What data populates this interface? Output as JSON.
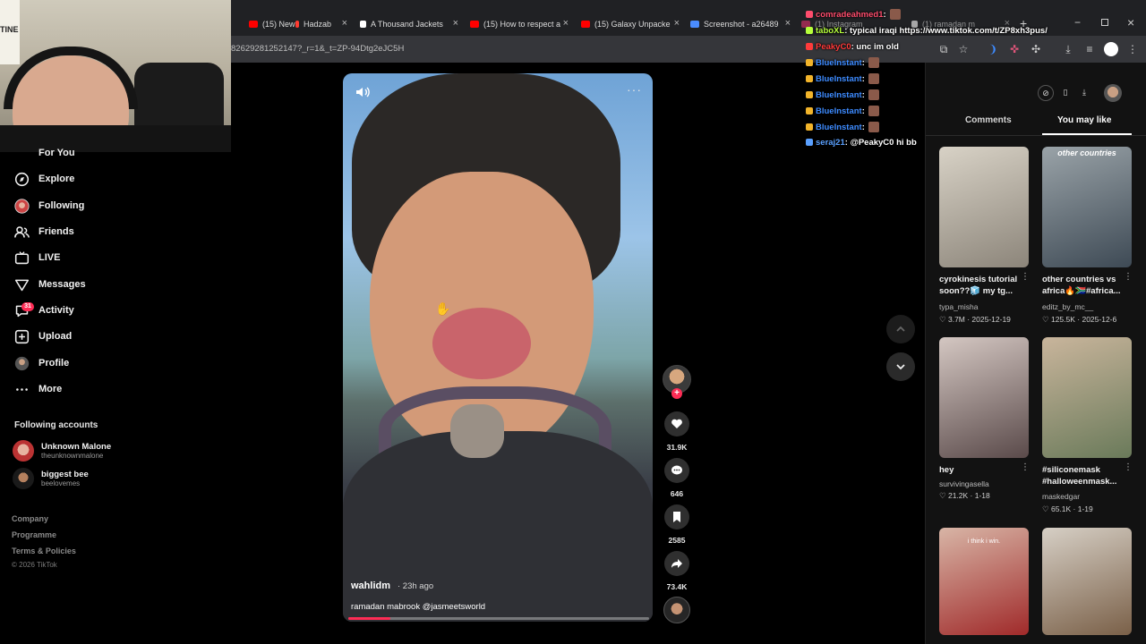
{
  "tabs": [
    {
      "label": "(15) New",
      "color": "#ff0000"
    },
    {
      "label": "Hadzab",
      "color": "#ff3b30"
    },
    {
      "label": "A Thousand Jackets",
      "color": "#ffffff"
    },
    {
      "label": "(15) How to respect a",
      "color": "#ff0000"
    },
    {
      "label": "(15) Galaxy Unpacke",
      "color": "#ff0000"
    },
    {
      "label": "Screenshot - a26489",
      "color": "#4a8cff"
    },
    {
      "label": "(1) Instagram",
      "color": "#e1306c"
    },
    {
      "label": "(1) ramadan m",
      "color": "#ffffff"
    }
  ],
  "address": {
    "url": "82629281252147?_r=1&_t=ZP-94Dtg2eJC5H"
  },
  "webcam": {
    "poster_text": "TINE"
  },
  "sidebar": {
    "items": [
      {
        "label": "For You",
        "icon": "home-icon"
      },
      {
        "label": "Explore",
        "icon": "compass-icon"
      },
      {
        "label": "Following",
        "icon": "following-avatar-icon"
      },
      {
        "label": "Friends",
        "icon": "friends-icon"
      },
      {
        "label": "LIVE",
        "icon": "live-icon"
      },
      {
        "label": "Messages",
        "icon": "messages-icon"
      },
      {
        "label": "Activity",
        "icon": "activity-icon",
        "badge": "31"
      },
      {
        "label": "Upload",
        "icon": "upload-icon"
      },
      {
        "label": "Profile",
        "icon": "profile-avatar-icon"
      },
      {
        "label": "More",
        "icon": "more-icon"
      }
    ],
    "following_title": "Following accounts",
    "accounts": [
      {
        "name": "Unknown Malone",
        "handle": "theunknownmalone"
      },
      {
        "name": "biggest bee",
        "handle": "beelovemes"
      }
    ],
    "footer": [
      "Company",
      "Programme",
      "Terms & Policies"
    ],
    "copyright": "© 2026 TikTok"
  },
  "video": {
    "author": "wahlidm",
    "posted": "· 23h ago",
    "caption": "ramadan mabrook @jasmeetsworld",
    "progress_fraction": 0.14,
    "more": "···"
  },
  "actions": {
    "likes": "31.9K",
    "comments": "646",
    "saves": "2585",
    "shares": "73.4K"
  },
  "chat": [
    {
      "user": "comradeahmed1",
      "color": "#ff4d6d",
      "message": ":"
    },
    {
      "user": "taboXL",
      "color": "#b6ff3b",
      "message": ": typical iraqi https://www.tiktok.com/t/ZP8xh3pus/"
    },
    {
      "user": "PeakyC0",
      "color": "#ff3b3b",
      "message": ": unc im old"
    },
    {
      "user": "BlueInstant",
      "color": "#3d8bff",
      "message": ":"
    },
    {
      "user": "BlueInstant",
      "color": "#3d8bff",
      "message": ":"
    },
    {
      "user": "BlueInstant",
      "color": "#3d8bff",
      "message": ":"
    },
    {
      "user": "BlueInstant",
      "color": "#3d8bff",
      "message": ":"
    },
    {
      "user": "BlueInstant",
      "color": "#3d8bff",
      "message": ":"
    },
    {
      "user": "seraj21",
      "color": "#5aa0ff",
      "message": ": @PeakyC0 hi bb"
    }
  ],
  "right_panel": {
    "tabs": [
      "Comments",
      "You may like"
    ],
    "active_tab": "You may like",
    "cards": [
      {
        "title": "cyrokinesis tutorial soon??🧊 my tg...",
        "user": "typa_misha",
        "stats": "♡ 3.7M · 2025-12-19",
        "overlay": "",
        "colors": [
          "#8c857a",
          "#d8d2c6"
        ]
      },
      {
        "title": "other countries vs africa🔥🇿🇦#africa...",
        "user": "editz_by_mc__",
        "stats": "♡ 125.5K · 2025-12-6",
        "overlay": "other countries",
        "colors": [
          "#3e4a55",
          "#9aa3a8"
        ]
      },
      {
        "title": "hey",
        "user": "survivingasella",
        "stats": "♡ 21.2K · 1-18",
        "overlay": "",
        "colors": [
          "#5a4a4a",
          "#d4c7c2"
        ]
      },
      {
        "title": "#siliconemask #halloweenmask...",
        "user": "maskedgar",
        "stats": "♡ 65.1K · 1-19",
        "overlay": "",
        "colors": [
          "#6a7a5a",
          "#c9b59c"
        ]
      },
      {
        "title": "",
        "user": "",
        "stats": "",
        "overlay": "i think i win.",
        "colors": [
          "#a02a2a",
          "#d8b5a6"
        ]
      },
      {
        "title": "",
        "user": "",
        "stats": "",
        "overlay": "",
        "colors": [
          "#7a6048",
          "#d6cfc5"
        ]
      }
    ]
  },
  "colors": {
    "accent": "#fe2c55",
    "background": "#000000",
    "panel": "#121212"
  }
}
